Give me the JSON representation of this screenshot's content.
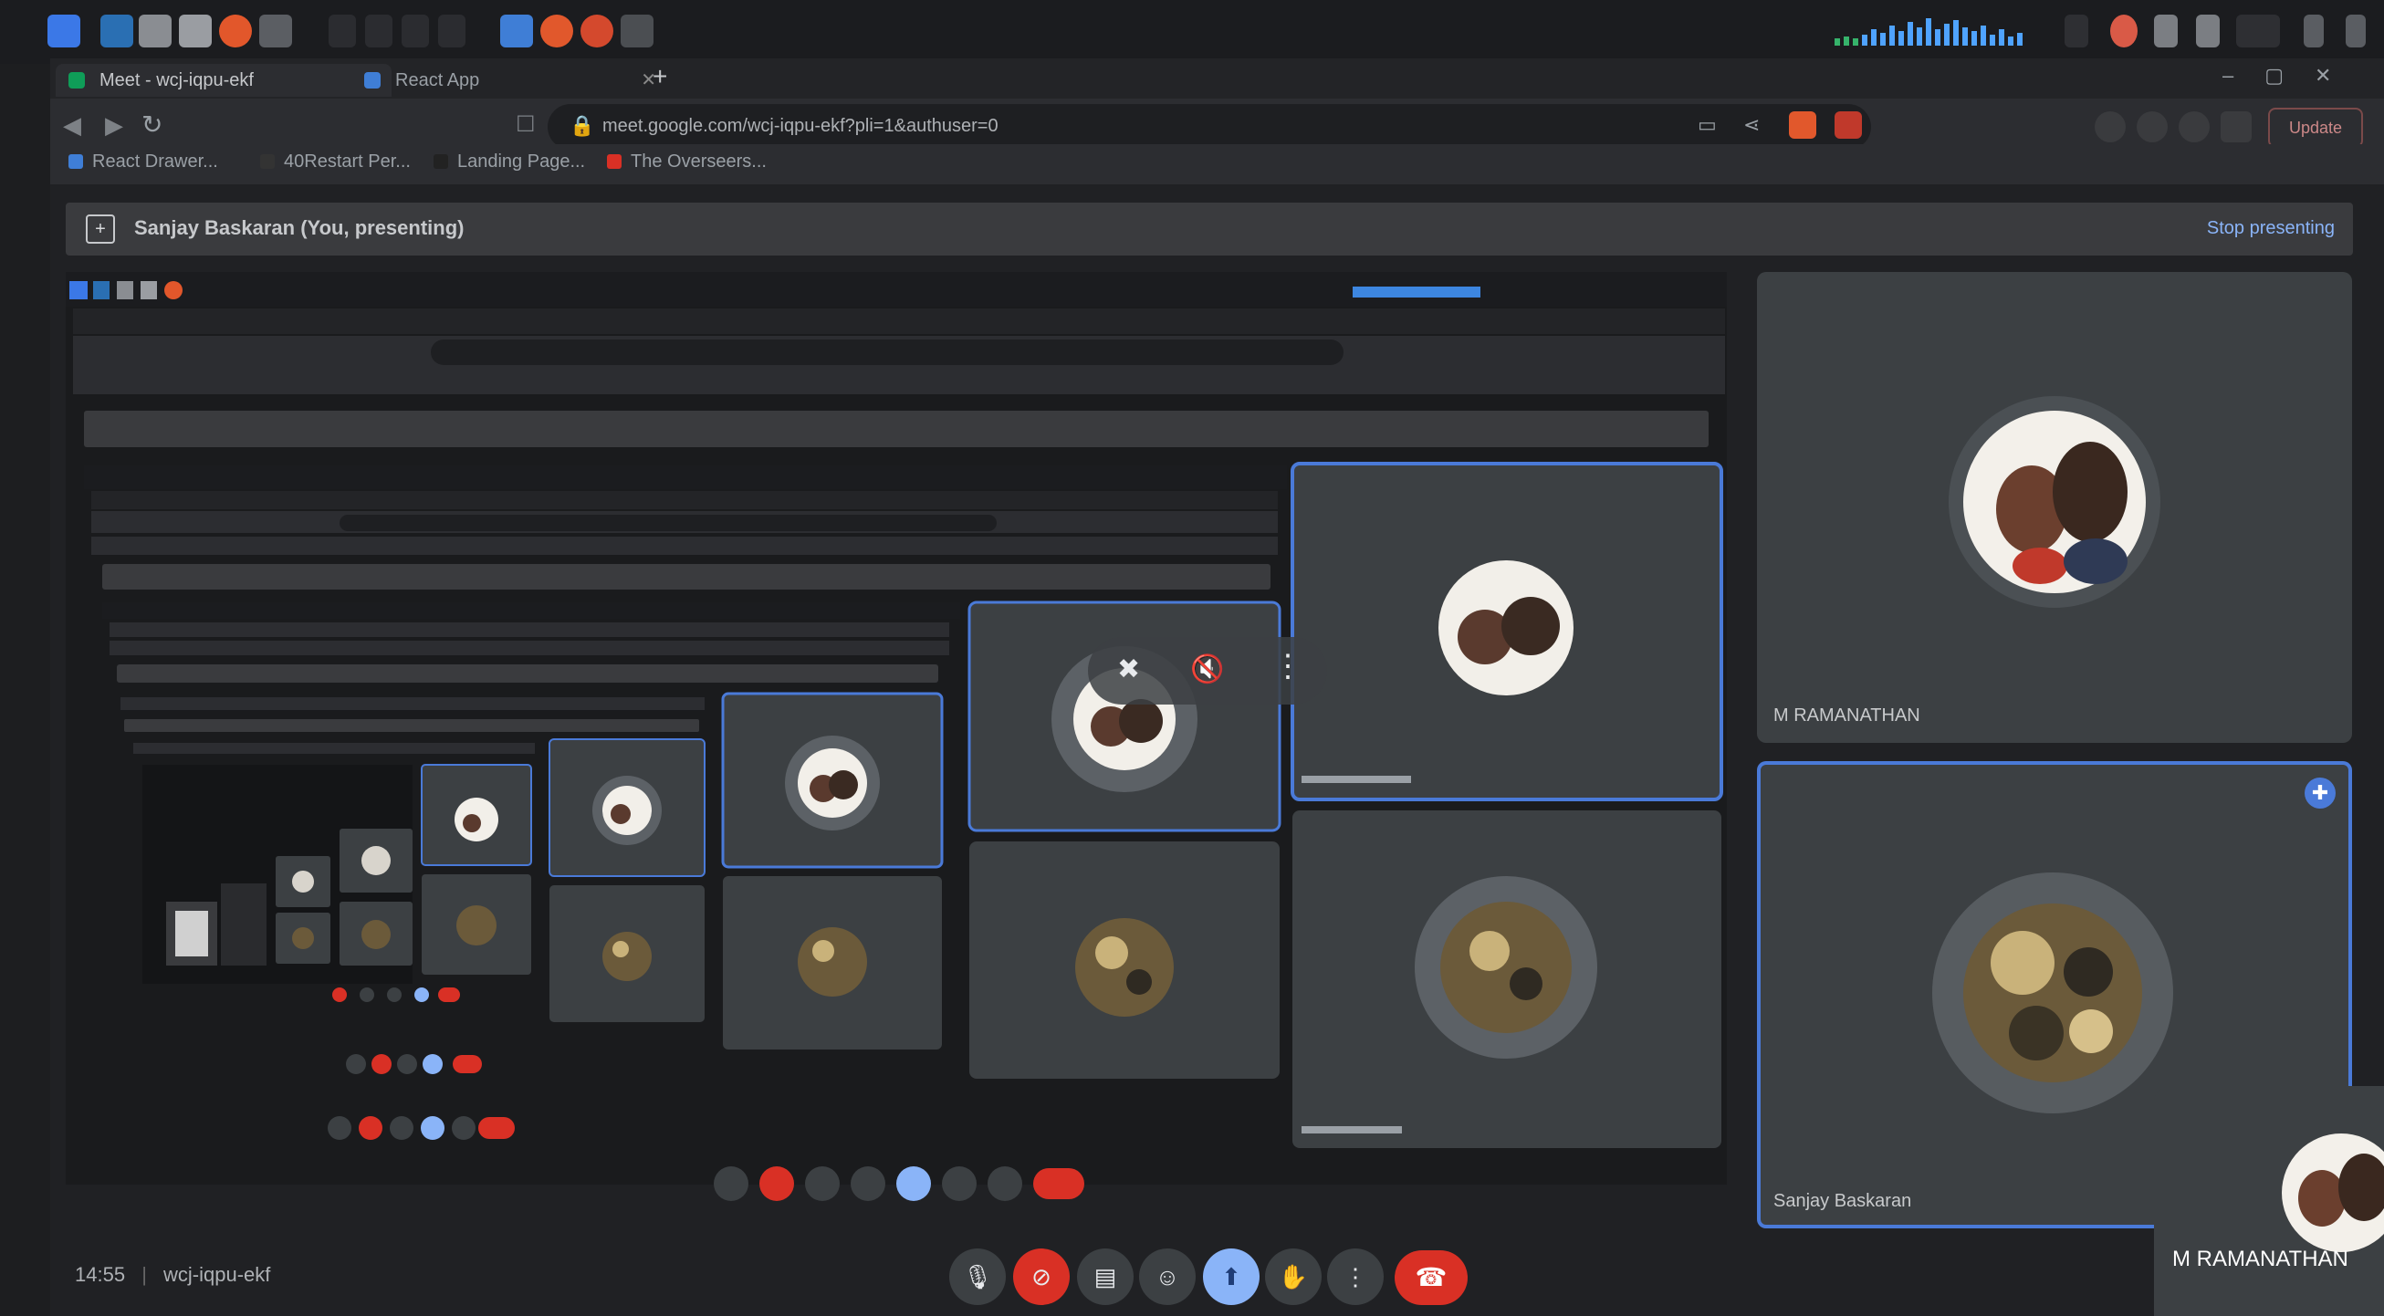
{
  "browser": {
    "tabs": [
      {
        "label": "Meet - wcj-iqpu-ekf",
        "active": true
      },
      {
        "label": "React App",
        "active": false
      }
    ],
    "url": "meet.google.com/wcj-iqpu-ekf?pli=1&authuser=0",
    "profile_label": "Update",
    "bookmarks": [
      "React Drawer...",
      "40Restart Per...",
      "Landing Page...",
      "The Overseers..."
    ]
  },
  "meet": {
    "presenting_banner": "Sanjay Baskaran (You, presenting)",
    "stop_presenting": "Stop presenting",
    "participants": [
      {
        "name": "M RAMANATHAN",
        "avatar": "couple-photo"
      },
      {
        "name": "Sanjay Baskaran",
        "avatar": "gear-photo"
      }
    ],
    "self_view_name": "M RAMANATHAN",
    "meeting_time": "14:55",
    "meeting_code": "wcj-iqpu-ekf",
    "controls": [
      {
        "name": "mic-button",
        "icon": "mic-icon"
      },
      {
        "name": "camera-button",
        "icon": "camera-off-icon"
      },
      {
        "name": "captions-button",
        "icon": "captions-icon"
      },
      {
        "name": "emoji-button",
        "icon": "emoji-icon"
      },
      {
        "name": "present-button",
        "icon": "present-icon"
      },
      {
        "name": "raise-hand-button",
        "icon": "hand-icon"
      },
      {
        "name": "more-options-button",
        "icon": "more-vert-icon"
      }
    ],
    "tile_actions": [
      "unpin-icon",
      "mute-icon",
      "more-vert-icon"
    ]
  },
  "colors": {
    "accent_blue": "#8ab4f8",
    "active_border": "#4a7ad8",
    "end_call_red": "#d93025",
    "tile_bg": "#3c4043",
    "page_bg": "#202124"
  }
}
